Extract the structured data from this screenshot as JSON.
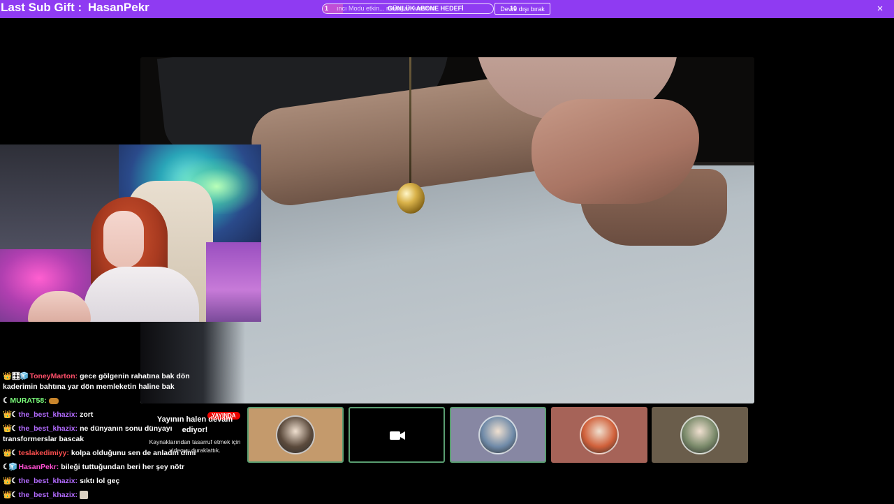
{
  "banner": {
    "sub_gift_label": "Last Sub Gift :",
    "sub_gift_name": "HasanPekr",
    "goal_count": "1",
    "goal_progress": 0.12,
    "goal_notice": "ıncı Modu etkin... mesajları kısaltıldı.",
    "goal_title": "GÜNLÜK ABONE HEDEFİ",
    "goal_target": "10",
    "disable_label": "Devre dışı bırak",
    "close_label": "×"
  },
  "chat": {
    "messages": [
      {
        "badges": "👑🎛🧊",
        "user": "ToneyMarton:",
        "user_color": "#ff4f6a",
        "text": "gece gölgenin rahatına bak dön kaderimin bahtına yar dön memleketin haline bak"
      },
      {
        "badges": "☾",
        "user": "MURAT58:",
        "user_color": "#7cff7c",
        "text": ""
      },
      {
        "badges": "👑☾",
        "user": "the_best_khazix:",
        "user_color": "#b36bff",
        "text": "zort"
      },
      {
        "badges": "👑☾",
        "user": "the_best_khazix:",
        "user_color": "#b36bff",
        "text": "ne dünyanın sonu dünyayı transformerslar bascak"
      },
      {
        "badges": "👑☾",
        "user": "teslakedimiyy:",
        "user_color": "#ff4f4f",
        "text": "kolpa olduğunu sen de anladın dimi"
      },
      {
        "badges": "☾🧊",
        "user": "HasanPekr:",
        "user_color": "#ff4fd2",
        "text": "bileği tuttuğundan beri her şey nötr"
      },
      {
        "badges": "👑☾",
        "user": "the_best_khazix:",
        "user_color": "#b36bff",
        "text": "sıktı lol geç"
      },
      {
        "badges": "👑☾",
        "user": "the_best_khazix:",
        "user_color": "#b36bff",
        "text": ""
      }
    ]
  },
  "paused": {
    "badge": "YAYINDA",
    "title": "Yayının halen devam ediyor!",
    "desc": "Kaynaklarından tasarruf etmek için videoyu duraklattık."
  },
  "tiles": [
    {
      "name": "tile-1",
      "bg": "#c49a6c",
      "active": true,
      "kind": "avatar",
      "avatar_color": "#5b4a3c"
    },
    {
      "name": "tile-2",
      "bg": "#000000",
      "active": true,
      "kind": "camera-off"
    },
    {
      "name": "tile-3",
      "bg": "#8787a3",
      "active": true,
      "kind": "avatar",
      "avatar_color": "#6f8aa8"
    },
    {
      "name": "tile-4",
      "bg": "#a66358",
      "active": false,
      "kind": "avatar",
      "avatar_color": "#d0603a"
    },
    {
      "name": "tile-5",
      "bg": "#6a5d4b",
      "active": false,
      "kind": "avatar",
      "avatar_color": "#7a8a6a"
    }
  ],
  "colors": {
    "banner": "#8f3bf2",
    "live": "#eb0400",
    "tile_active_border": "#5a9e71"
  }
}
